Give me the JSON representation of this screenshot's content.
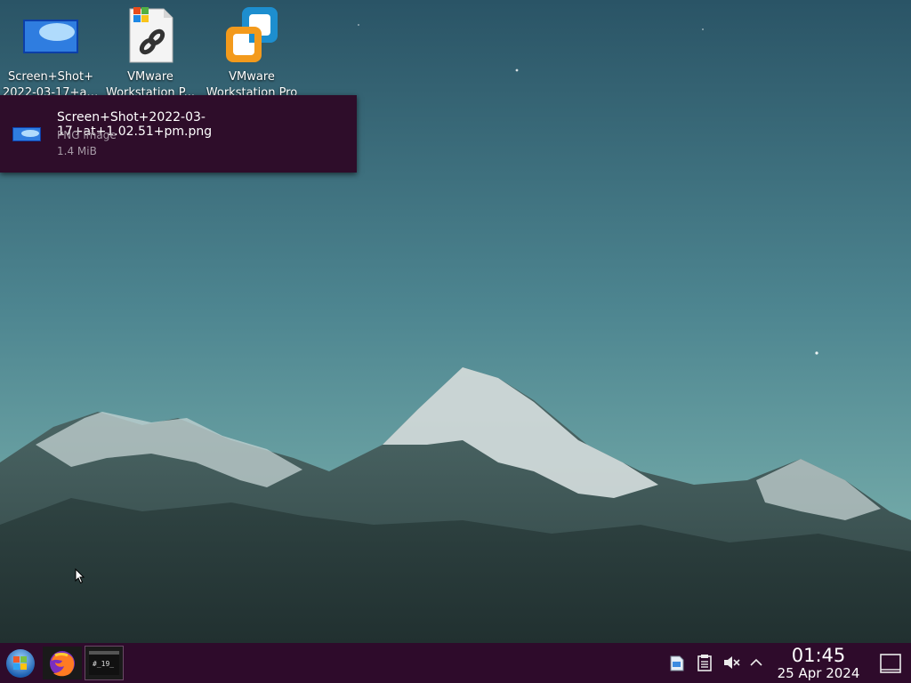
{
  "desktop": {
    "icons": [
      {
        "label": "Screen+Shot+\n2022-03-17+at...",
        "icon": "png-image-icon"
      },
      {
        "label": "VMware\nWorkstation P...",
        "icon": "windows-shortcut-icon"
      },
      {
        "label": "VMware\nWorkstation Pro",
        "icon": "vmware-icon"
      }
    ]
  },
  "tooltip": {
    "filename": "Screen+Shot+2022-03-17+at+1.02.51+pm.png",
    "type": "PNG image",
    "size": "1.4 MiB"
  },
  "taskbar": {
    "launcher_icon": "application-launcher-icon",
    "tasks": [
      {
        "name": "Firefox",
        "icon": "firefox-icon"
      },
      {
        "name": "Terminal",
        "icon": "terminal-icon"
      }
    ],
    "tray": [
      {
        "icon": "files-icon"
      },
      {
        "icon": "clipboard-icon"
      },
      {
        "icon": "audio-muted-icon"
      },
      {
        "icon": "chevron-up-icon"
      }
    ],
    "clock": {
      "time": "01:45",
      "date": "25 Apr 2024"
    },
    "show_desktop_icon": "show-desktop-icon"
  },
  "colors": {
    "taskbar_bg": "#2e0b2b",
    "tooltip_bg": "#2e0d2a"
  }
}
